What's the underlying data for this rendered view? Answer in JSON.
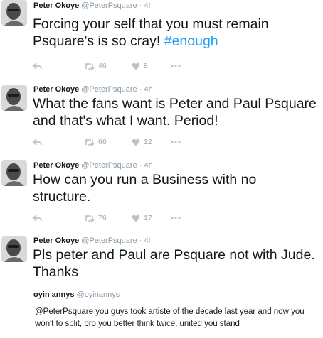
{
  "colors": {
    "link": "#1da1f2",
    "muted": "#8899a6",
    "action": "#b8c4cd"
  },
  "tweets": [
    {
      "name": "Peter Okoye",
      "handle": "@PeterPsquare",
      "time": "4h",
      "text": "Forcing your self that you must remain Psquare's is so cray! ",
      "hashtag": "#enough",
      "retweets": "46",
      "likes": "8"
    },
    {
      "name": "Peter Okoye",
      "handle": "@PeterPsquare",
      "time": "4h",
      "text": "What the fans want is Peter and Paul Psquare and that's what I want. Period!",
      "retweets": "66",
      "likes": "12"
    },
    {
      "name": "Peter Okoye",
      "handle": "@PeterPsquare",
      "time": "4h",
      "text": "How can you run a Business with no structure.",
      "retweets": "76",
      "likes": "17"
    },
    {
      "name": "Peter Okoye",
      "handle": "@PeterPsquare",
      "time": "4h",
      "text": "Pls peter and Paul are Psquare not with Jude. Thanks"
    }
  ],
  "quoted": {
    "name": "oyin annys",
    "handle": "@oyinannys",
    "text": "@PeterPsquare  you guys took artiste of the decade last year and now you won't to split, bro you better think twice, united you stand"
  }
}
